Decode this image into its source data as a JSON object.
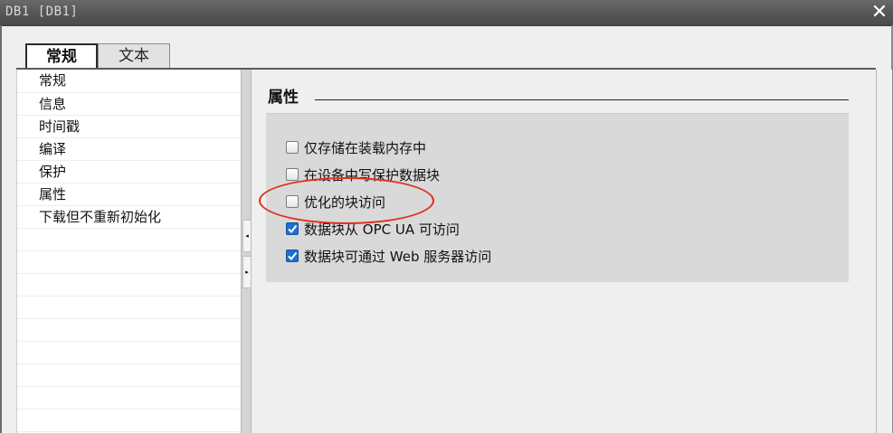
{
  "window": {
    "title": "DB1 [DB1]",
    "close_glyph": "✕"
  },
  "tabs": [
    {
      "label": "常规",
      "active": true
    },
    {
      "label": "文本",
      "active": false
    }
  ],
  "sidebar": {
    "items": [
      {
        "label": "常规"
      },
      {
        "label": "信息"
      },
      {
        "label": "时间戳"
      },
      {
        "label": "编译"
      },
      {
        "label": "保护"
      },
      {
        "label": "属性",
        "selected": true
      },
      {
        "label": "下载但不重新初始化"
      }
    ]
  },
  "splitter": {
    "collapse_glyph": "◂",
    "expand_glyph": "▸"
  },
  "main": {
    "section_title": "属性",
    "options": [
      {
        "label": "仅存储在装载内存中",
        "checked": false
      },
      {
        "label": "在设备中写保护数据块",
        "checked": false
      },
      {
        "label": "优化的块访问",
        "checked": false
      },
      {
        "label": "数据块从 OPC UA 可访问",
        "checked": true
      },
      {
        "label": "数据块可通过 Web 服务器访问",
        "checked": true
      }
    ]
  },
  "colors": {
    "checkbox_checked": "#1f6fd0",
    "annotation": "#e0301e"
  }
}
